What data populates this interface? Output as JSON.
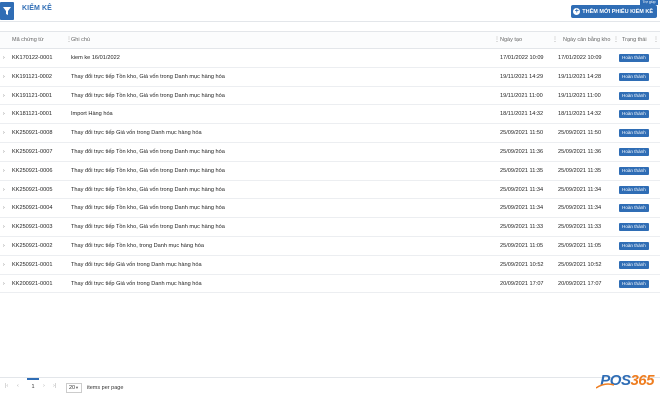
{
  "header": {
    "title": "KIỂM KÊ",
    "add_button": "THÊM MỚI PHIẾU KIỂM KÊ",
    "help_tag": "Trợ giúp"
  },
  "table": {
    "columns": [
      "Mã chứng từ",
      "Ghi chú",
      "Ngày tạo",
      "Ngày cân bằng kho",
      "Trạng thái"
    ],
    "rows": [
      {
        "code": "KK170122-0001",
        "note": "kiem ke 16/01/2022",
        "created": "17/01/2022 10:09",
        "balanced": "17/01/2022 10:09",
        "status": "Hoàn thành"
      },
      {
        "code": "KK191121-0002",
        "note": "Thay đổi trực tiếp Tồn kho, Giá vốn trong Danh mục hàng hóa",
        "created": "19/11/2021 14:29",
        "balanced": "19/11/2021 14:28",
        "status": "Hoàn thành"
      },
      {
        "code": "KK191121-0001",
        "note": "Thay đổi trực tiếp Tồn kho, Giá vốn trong Danh mục hàng hóa",
        "created": "19/11/2021 11:00",
        "balanced": "19/11/2021 11:00",
        "status": "Hoàn thành"
      },
      {
        "code": "KK181121-0001",
        "note": "Import Hàng hóa",
        "created": "18/11/2021 14:32",
        "balanced": "18/11/2021 14:32",
        "status": "Hoàn thành"
      },
      {
        "code": "KK250921-0008",
        "note": "Thay đổi trực tiếp Giá vốn trong Danh mục hàng hóa",
        "created": "25/09/2021 11:50",
        "balanced": "25/09/2021 11:50",
        "status": "Hoàn thành"
      },
      {
        "code": "KK250921-0007",
        "note": "Thay đổi trực tiếp Tồn kho, Giá vốn trong Danh mục hàng hóa",
        "created": "25/09/2021 11:36",
        "balanced": "25/09/2021 11:36",
        "status": "Hoàn thành"
      },
      {
        "code": "KK250921-0006",
        "note": "Thay đổi trực tiếp Tồn kho, Giá vốn trong Danh mục hàng hóa",
        "created": "25/09/2021 11:35",
        "balanced": "25/09/2021 11:35",
        "status": "Hoàn thành"
      },
      {
        "code": "KK250921-0005",
        "note": "Thay đổi trực tiếp Tồn kho, Giá vốn trong Danh mục hàng hóa",
        "created": "25/09/2021 11:34",
        "balanced": "25/09/2021 11:34",
        "status": "Hoàn thành"
      },
      {
        "code": "KK250921-0004",
        "note": "Thay đổi trực tiếp Tồn kho, Giá vốn trong Danh mục hàng hóa",
        "created": "25/09/2021 11:34",
        "balanced": "25/09/2021 11:34",
        "status": "Hoàn thành"
      },
      {
        "code": "KK250921-0003",
        "note": "Thay đổi trực tiếp Tồn kho, Giá vốn trong Danh mục hàng hóa",
        "created": "25/09/2021 11:33",
        "balanced": "25/09/2021 11:33",
        "status": "Hoàn thành"
      },
      {
        "code": "KK250921-0002",
        "note": "Thay đổi trực tiếp Tồn kho, trong Danh mục hàng hóa",
        "created": "25/09/2021 11:05",
        "balanced": "25/09/2021 11:05",
        "status": "Hoàn thành"
      },
      {
        "code": "KK250921-0001",
        "note": "Thay đổi trực tiếp Giá vốn trong Danh mục hàng hóa",
        "created": "25/09/2021 10:52",
        "balanced": "25/09/2021 10:52",
        "status": "Hoàn thành"
      },
      {
        "code": "KK200921-0001",
        "note": "Thay đổi trực tiếp Giá vốn trong Danh mục hàng hóa",
        "created": "20/09/2021 17:07",
        "balanced": "20/09/2021 17:07",
        "status": "Hoàn thành"
      }
    ]
  },
  "pager": {
    "current_page": "1",
    "per_page": "20",
    "per_page_label": "items per page"
  },
  "logo": {
    "part1": "P",
    "part2": "OS",
    "part3": "365"
  },
  "colors": {
    "accent": "#2f6db5",
    "logo_orange": "#ee7d20"
  }
}
